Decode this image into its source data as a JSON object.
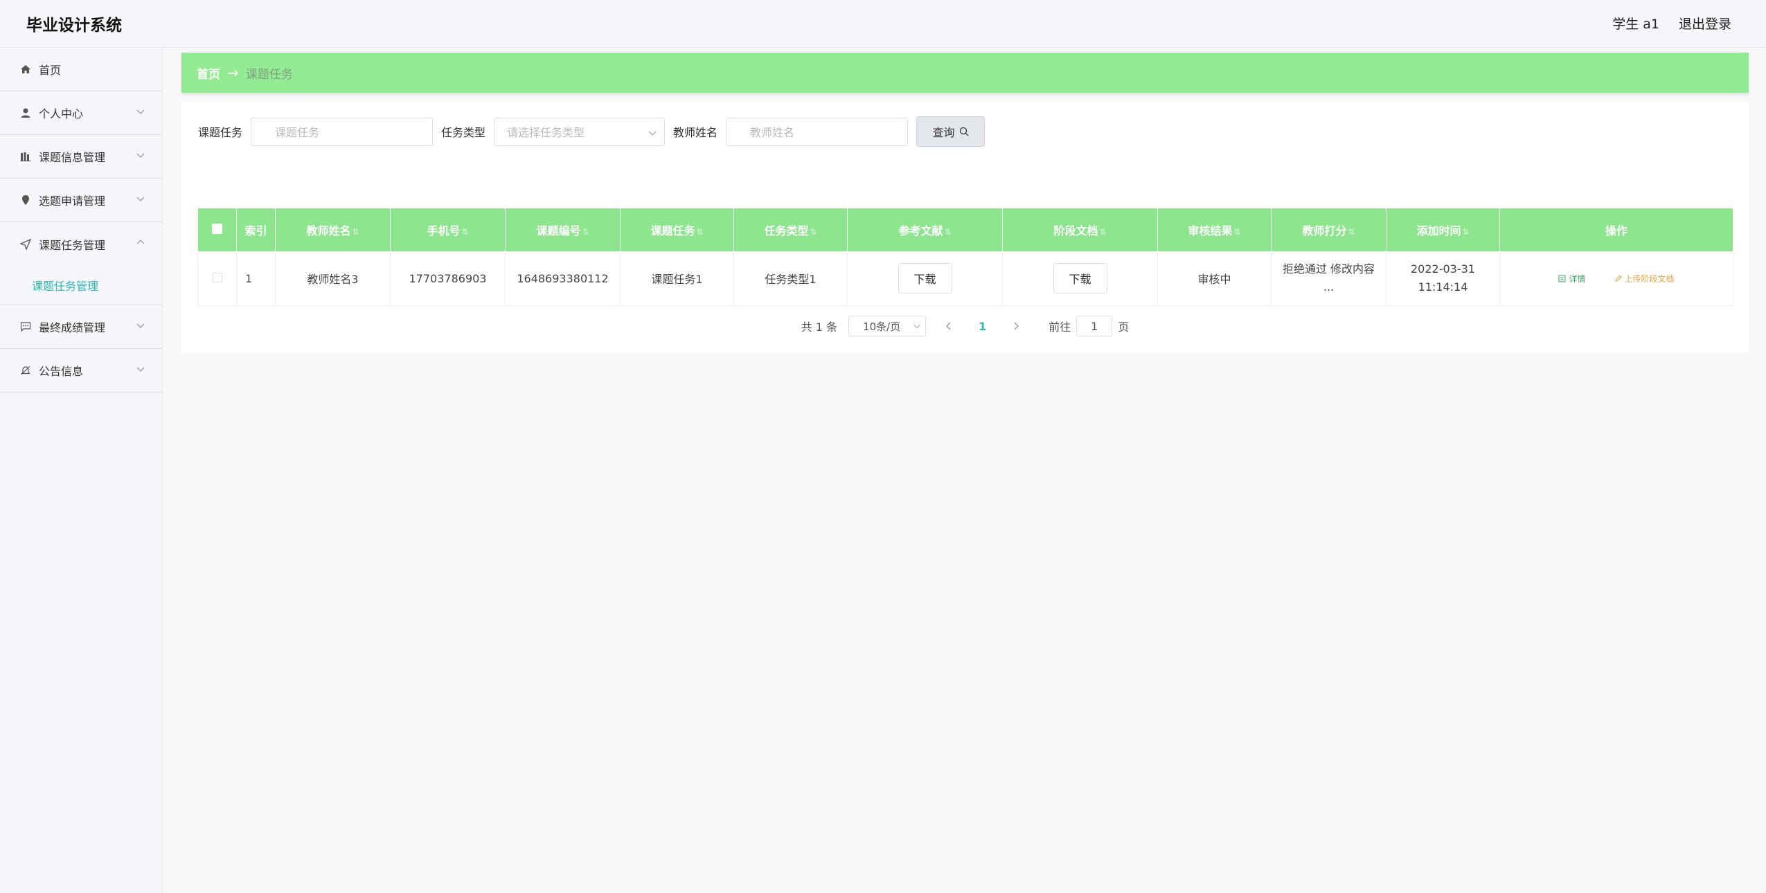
{
  "header": {
    "title": "毕业设计系统",
    "user": "学生 a1",
    "logout": "退出登录"
  },
  "sidebar": {
    "items": [
      {
        "label": "首页",
        "icon": "home-icon"
      },
      {
        "label": "个人中心",
        "icon": "user-icon"
      },
      {
        "label": "课题信息管理",
        "icon": "chart-icon"
      },
      {
        "label": "选题申请管理",
        "icon": "pin-icon"
      },
      {
        "label": "课题任务管理",
        "icon": "send-icon"
      },
      {
        "label": "最终成绩管理",
        "icon": "message-icon"
      },
      {
        "label": "公告信息",
        "icon": "bell-off-icon"
      }
    ],
    "active_sub": "课题任务管理"
  },
  "breadcrumb": {
    "home": "首页",
    "arrow": "→",
    "current": "课题任务"
  },
  "search": {
    "task_label": "课题任务",
    "task_placeholder": "课题任务",
    "type_label": "任务类型",
    "type_placeholder": "请选择任务类型",
    "teacher_label": "教师姓名",
    "teacher_placeholder": "教师姓名",
    "query_button": "查询"
  },
  "table": {
    "columns": [
      "索引",
      "教师姓名",
      "手机号",
      "课题编号",
      "课题任务",
      "任务类型",
      "参考文献",
      "阶段文档",
      "审核结果",
      "教师打分",
      "添加时间",
      "操作"
    ],
    "rows": [
      {
        "index": "1",
        "teacher": "教师姓名3",
        "phone": "17703786903",
        "topic_no": "1648693380112",
        "task": "课题任务1",
        "type": "任务类型1",
        "ref_download": "下载",
        "doc_download": "下载",
        "review": "审核中",
        "score": "拒绝通过 修改内容 ...",
        "time": "2022-03-31 11:14:14",
        "op_detail": "详情",
        "op_upload": "上传阶段文档"
      }
    ]
  },
  "pagination": {
    "total": "共 1 条",
    "page_size": "10条/页",
    "current": "1",
    "goto_prefix": "前往",
    "goto_value": "1",
    "goto_suffix": "页"
  },
  "colors": {
    "accent": "#92eb92",
    "table_header": "#8de58d",
    "active_link": "#2fb8b0"
  }
}
